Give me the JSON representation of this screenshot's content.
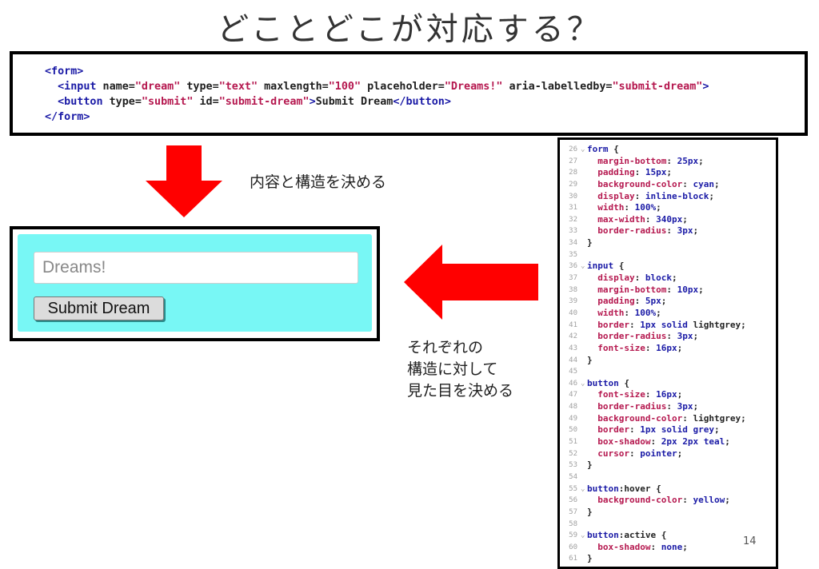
{
  "slide": {
    "title": "どことどこが対応する？",
    "note_top": "内容と構造を決める",
    "note_bottom_lines": [
      "それぞれの",
      "構造に対して",
      "見た目を決める"
    ],
    "page_number": "14"
  },
  "html_code": {
    "lines": [
      [
        {
          "t": "tag",
          "v": "<form>"
        }
      ],
      [
        {
          "t": "txt",
          "v": "  "
        },
        {
          "t": "tag",
          "v": "<input"
        },
        {
          "t": "attr",
          "v": " name="
        },
        {
          "t": "val",
          "v": "\"dream\""
        },
        {
          "t": "attr",
          "v": " type="
        },
        {
          "t": "val",
          "v": "\"text\""
        },
        {
          "t": "attr",
          "v": " maxlength="
        },
        {
          "t": "val",
          "v": "\"100\""
        },
        {
          "t": "attr",
          "v": " placeholder="
        },
        {
          "t": "val",
          "v": "\"Dreams!\""
        },
        {
          "t": "attr",
          "v": " aria-labelledby="
        },
        {
          "t": "val",
          "v": "\"submit-dream\""
        },
        {
          "t": "tag",
          "v": ">"
        }
      ],
      [
        {
          "t": "txt",
          "v": "  "
        },
        {
          "t": "tag",
          "v": "<button"
        },
        {
          "t": "attr",
          "v": " type="
        },
        {
          "t": "val",
          "v": "\"submit\""
        },
        {
          "t": "attr",
          "v": " id="
        },
        {
          "t": "val",
          "v": "\"submit-dream\""
        },
        {
          "t": "tag",
          "v": ">"
        },
        {
          "t": "txt",
          "v": "Submit Dream"
        },
        {
          "t": "tag",
          "v": "</button>"
        }
      ],
      [
        {
          "t": "tag",
          "v": "</form>"
        }
      ]
    ]
  },
  "preview": {
    "input_placeholder": "Dreams!",
    "button_label": "Submit Dream",
    "form_bg_color": "#78f7f5"
  },
  "arrows": {
    "color": "#ff0000"
  },
  "css_code": {
    "lines": [
      {
        "n": "26",
        "fold": true,
        "parts": [
          {
            "t": "sel",
            "v": "form"
          },
          {
            "t": "punct",
            "v": " {"
          }
        ]
      },
      {
        "n": "27",
        "parts": [
          {
            "t": "plain",
            "v": "  "
          },
          {
            "t": "prop",
            "v": "margin-bottom"
          },
          {
            "t": "punct",
            "v": ": "
          },
          {
            "t": "cval",
            "v": "25px"
          },
          {
            "t": "punct",
            "v": ";"
          }
        ]
      },
      {
        "n": "28",
        "parts": [
          {
            "t": "plain",
            "v": "  "
          },
          {
            "t": "prop",
            "v": "padding"
          },
          {
            "t": "punct",
            "v": ": "
          },
          {
            "t": "cval",
            "v": "15px"
          },
          {
            "t": "punct",
            "v": ";"
          }
        ]
      },
      {
        "n": "29",
        "parts": [
          {
            "t": "plain",
            "v": "  "
          },
          {
            "t": "prop",
            "v": "background-color"
          },
          {
            "t": "punct",
            "v": ": "
          },
          {
            "t": "cval",
            "v": "cyan"
          },
          {
            "t": "punct",
            "v": ";"
          }
        ]
      },
      {
        "n": "30",
        "parts": [
          {
            "t": "plain",
            "v": "  "
          },
          {
            "t": "prop",
            "v": "display"
          },
          {
            "t": "punct",
            "v": ": "
          },
          {
            "t": "cval",
            "v": "inline-block"
          },
          {
            "t": "punct",
            "v": ";"
          }
        ]
      },
      {
        "n": "31",
        "parts": [
          {
            "t": "plain",
            "v": "  "
          },
          {
            "t": "prop",
            "v": "width"
          },
          {
            "t": "punct",
            "v": ": "
          },
          {
            "t": "cval",
            "v": "100%"
          },
          {
            "t": "punct",
            "v": ";"
          }
        ]
      },
      {
        "n": "32",
        "parts": [
          {
            "t": "plain",
            "v": "  "
          },
          {
            "t": "prop",
            "v": "max-width"
          },
          {
            "t": "punct",
            "v": ": "
          },
          {
            "t": "cval",
            "v": "340px"
          },
          {
            "t": "punct",
            "v": ";"
          }
        ]
      },
      {
        "n": "33",
        "parts": [
          {
            "t": "plain",
            "v": "  "
          },
          {
            "t": "prop",
            "v": "border-radius"
          },
          {
            "t": "punct",
            "v": ": "
          },
          {
            "t": "cval",
            "v": "3px"
          },
          {
            "t": "punct",
            "v": ";"
          }
        ]
      },
      {
        "n": "34",
        "parts": [
          {
            "t": "punct",
            "v": "}"
          }
        ]
      },
      {
        "n": "35",
        "parts": []
      },
      {
        "n": "36",
        "fold": true,
        "parts": [
          {
            "t": "sel",
            "v": "input"
          },
          {
            "t": "punct",
            "v": " {"
          }
        ]
      },
      {
        "n": "37",
        "parts": [
          {
            "t": "plain",
            "v": "  "
          },
          {
            "t": "prop",
            "v": "display"
          },
          {
            "t": "punct",
            "v": ": "
          },
          {
            "t": "cval",
            "v": "block"
          },
          {
            "t": "punct",
            "v": ";"
          }
        ]
      },
      {
        "n": "38",
        "parts": [
          {
            "t": "plain",
            "v": "  "
          },
          {
            "t": "prop",
            "v": "margin-bottom"
          },
          {
            "t": "punct",
            "v": ": "
          },
          {
            "t": "cval",
            "v": "10px"
          },
          {
            "t": "punct",
            "v": ";"
          }
        ]
      },
      {
        "n": "39",
        "parts": [
          {
            "t": "plain",
            "v": "  "
          },
          {
            "t": "prop",
            "v": "padding"
          },
          {
            "t": "punct",
            "v": ": "
          },
          {
            "t": "cval",
            "v": "5px"
          },
          {
            "t": "punct",
            "v": ";"
          }
        ]
      },
      {
        "n": "40",
        "parts": [
          {
            "t": "plain",
            "v": "  "
          },
          {
            "t": "prop",
            "v": "width"
          },
          {
            "t": "punct",
            "v": ": "
          },
          {
            "t": "cval",
            "v": "100%"
          },
          {
            "t": "punct",
            "v": ";"
          }
        ]
      },
      {
        "n": "41",
        "parts": [
          {
            "t": "plain",
            "v": "  "
          },
          {
            "t": "prop",
            "v": "border"
          },
          {
            "t": "punct",
            "v": ": "
          },
          {
            "t": "cval",
            "v": "1px"
          },
          {
            "t": "plain",
            "v": " "
          },
          {
            "t": "cval",
            "v": "solid"
          },
          {
            "t": "plain",
            "v": " lightgrey"
          },
          {
            "t": "punct",
            "v": ";"
          }
        ]
      },
      {
        "n": "42",
        "parts": [
          {
            "t": "plain",
            "v": "  "
          },
          {
            "t": "prop",
            "v": "border-radius"
          },
          {
            "t": "punct",
            "v": ": "
          },
          {
            "t": "cval",
            "v": "3px"
          },
          {
            "t": "punct",
            "v": ";"
          }
        ]
      },
      {
        "n": "43",
        "parts": [
          {
            "t": "plain",
            "v": "  "
          },
          {
            "t": "prop",
            "v": "font-size"
          },
          {
            "t": "punct",
            "v": ": "
          },
          {
            "t": "cval",
            "v": "16px"
          },
          {
            "t": "punct",
            "v": ";"
          }
        ]
      },
      {
        "n": "44",
        "parts": [
          {
            "t": "punct",
            "v": "}"
          }
        ]
      },
      {
        "n": "45",
        "parts": []
      },
      {
        "n": "46",
        "fold": true,
        "parts": [
          {
            "t": "sel",
            "v": "button"
          },
          {
            "t": "punct",
            "v": " {"
          }
        ]
      },
      {
        "n": "47",
        "parts": [
          {
            "t": "plain",
            "v": "  "
          },
          {
            "t": "prop",
            "v": "font-size"
          },
          {
            "t": "punct",
            "v": ": "
          },
          {
            "t": "cval",
            "v": "16px"
          },
          {
            "t": "punct",
            "v": ";"
          }
        ]
      },
      {
        "n": "48",
        "parts": [
          {
            "t": "plain",
            "v": "  "
          },
          {
            "t": "prop",
            "v": "border-radius"
          },
          {
            "t": "punct",
            "v": ": "
          },
          {
            "t": "cval",
            "v": "3px"
          },
          {
            "t": "punct",
            "v": ";"
          }
        ]
      },
      {
        "n": "49",
        "parts": [
          {
            "t": "plain",
            "v": "  "
          },
          {
            "t": "prop",
            "v": "background-color"
          },
          {
            "t": "punct",
            "v": ": "
          },
          {
            "t": "plain",
            "v": "lightgrey"
          },
          {
            "t": "punct",
            "v": ";"
          }
        ]
      },
      {
        "n": "50",
        "parts": [
          {
            "t": "plain",
            "v": "  "
          },
          {
            "t": "prop",
            "v": "border"
          },
          {
            "t": "punct",
            "v": ": "
          },
          {
            "t": "cval",
            "v": "1px"
          },
          {
            "t": "plain",
            "v": " "
          },
          {
            "t": "cval",
            "v": "solid"
          },
          {
            "t": "plain",
            "v": " "
          },
          {
            "t": "cval",
            "v": "grey"
          },
          {
            "t": "punct",
            "v": ";"
          }
        ]
      },
      {
        "n": "51",
        "parts": [
          {
            "t": "plain",
            "v": "  "
          },
          {
            "t": "prop",
            "v": "box-shadow"
          },
          {
            "t": "punct",
            "v": ": "
          },
          {
            "t": "cval",
            "v": "2px"
          },
          {
            "t": "plain",
            "v": " "
          },
          {
            "t": "cval",
            "v": "2px"
          },
          {
            "t": "plain",
            "v": " "
          },
          {
            "t": "cval",
            "v": "teal"
          },
          {
            "t": "punct",
            "v": ";"
          }
        ]
      },
      {
        "n": "52",
        "parts": [
          {
            "t": "plain",
            "v": "  "
          },
          {
            "t": "prop",
            "v": "cursor"
          },
          {
            "t": "punct",
            "v": ": "
          },
          {
            "t": "cval",
            "v": "pointer"
          },
          {
            "t": "punct",
            "v": ";"
          }
        ]
      },
      {
        "n": "53",
        "parts": [
          {
            "t": "punct",
            "v": "}"
          }
        ]
      },
      {
        "n": "54",
        "parts": []
      },
      {
        "n": "55",
        "fold": true,
        "parts": [
          {
            "t": "sel",
            "v": "button"
          },
          {
            "t": "plain",
            "v": ":hover"
          },
          {
            "t": "punct",
            "v": " {"
          }
        ]
      },
      {
        "n": "56",
        "parts": [
          {
            "t": "plain",
            "v": "  "
          },
          {
            "t": "prop",
            "v": "background-color"
          },
          {
            "t": "punct",
            "v": ": "
          },
          {
            "t": "cval",
            "v": "yellow"
          },
          {
            "t": "punct",
            "v": ";"
          }
        ]
      },
      {
        "n": "57",
        "parts": [
          {
            "t": "punct",
            "v": "}"
          }
        ]
      },
      {
        "n": "58",
        "parts": []
      },
      {
        "n": "59",
        "fold": true,
        "parts": [
          {
            "t": "sel",
            "v": "button"
          },
          {
            "t": "plain",
            "v": ":active"
          },
          {
            "t": "punct",
            "v": " {"
          }
        ]
      },
      {
        "n": "60",
        "parts": [
          {
            "t": "plain",
            "v": "  "
          },
          {
            "t": "prop",
            "v": "box-shadow"
          },
          {
            "t": "punct",
            "v": ": "
          },
          {
            "t": "cval",
            "v": "none"
          },
          {
            "t": "punct",
            "v": ";"
          }
        ]
      },
      {
        "n": "61",
        "parts": [
          {
            "t": "punct",
            "v": "}"
          }
        ]
      }
    ]
  }
}
